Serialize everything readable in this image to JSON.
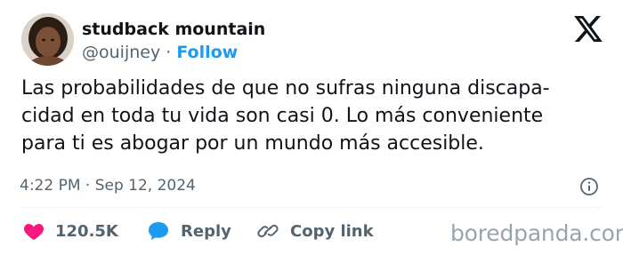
{
  "author": {
    "display_name": "studback mountain",
    "handle": "@ouijney",
    "separator": "·",
    "follow_label": "Follow"
  },
  "tweet": {
    "lines": [
      "Las probabilidades de que no sufras ninguna discapa-",
      "cidad en toda tu vida son casi 0. Lo más conveniente",
      "para ti es abogar por un mundo más accesible."
    ],
    "timestamp": "4:22 PM · Sep 12, 2024"
  },
  "actions": {
    "like_count": "120.5K",
    "reply_label": "Reply",
    "copy_label": "Copy link"
  },
  "watermark": "boredpanda.com",
  "icons": {
    "logo": "x-logo-icon",
    "info": "info-icon",
    "like": "heart-icon",
    "reply": "speech-bubble-icon",
    "copy": "link-icon"
  },
  "colors": {
    "accent": "#1d9bf0",
    "like": "#f91880",
    "text": "#0f1419",
    "muted": "#536471"
  }
}
